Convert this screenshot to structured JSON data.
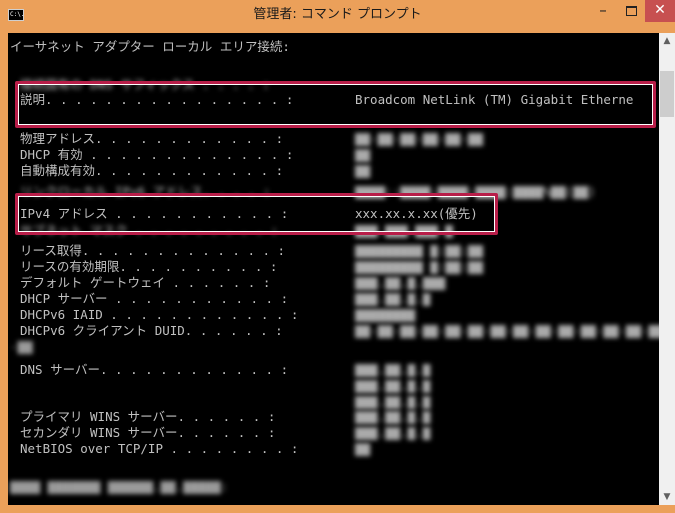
{
  "window": {
    "title": "管理者: コマンド プロンプト",
    "icon_text": "C:\\.",
    "min_label": "–",
    "close_label": "✕"
  },
  "console": {
    "header": "イーサネット アダプター ローカル エリア接続:",
    "connection_dns_suffix": {
      "label": "接続固有の DNS サフィックス . . . . :",
      "value": ""
    },
    "description": {
      "label": "説明. . . . . . . . . . . . . . . . :",
      "value": "Broadcom NetLink (TM) Gigabit Etherne"
    },
    "physical_address": {
      "label": "物理アドレス. . . . . . . . . . . . :",
      "value": ""
    },
    "dhcp_enabled": {
      "label": "DHCP 有効 . . . . . . . . . . . . . :",
      "value": ""
    },
    "autoconfig_enabled": {
      "label": "自動構成有効. . . . . . . . . . . . :",
      "value": ""
    },
    "link_local_ipv6": {
      "label": "リンクローカル IPv6 アドレス. . . . :",
      "value": ""
    },
    "ipv4_address": {
      "label": "IPv4 アドレス . . . . . . . . . . . :",
      "value": "xxx.xx.x.xx(優先)"
    },
    "subnet_mask": {
      "label": "サブネット マスク . . . . . . . . . :",
      "value": ""
    },
    "lease_obtained": {
      "label": "リース取得. . . . . . . . . . . . . :",
      "value": ""
    },
    "lease_expires": {
      "label": "リースの有効期限. . . . . . . . . . :",
      "value": ""
    },
    "default_gateway": {
      "label": "デフォルト ゲートウェイ . . . . . . :",
      "value": ""
    },
    "dhcp_server": {
      "label": "DHCP サーバー . . . . . . . . . . . :",
      "value": ""
    },
    "dhcpv6_iaid": {
      "label": "DHCPv6 IAID . . . . . . . . . . . . :",
      "value": ""
    },
    "dhcpv6_duid": {
      "label": "DHCPv6 クライアント DUID. . . . . . :",
      "value": ""
    },
    "dns_servers": {
      "label": "DNS サーバー. . . . . . . . . . . . :",
      "value": ""
    },
    "primary_wins": {
      "label": "プライマリ WINS サーバー. . . . . . :",
      "value": ""
    },
    "secondary_wins": {
      "label": "セカンダリ WINS サーバー. . . . . . :",
      "value": ""
    },
    "netbios": {
      "label": "NetBIOS over TCP/IP . . . . . . . . :",
      "value": ""
    }
  },
  "colors": {
    "title_bar": "#eba05a",
    "close_button": "#c75050",
    "console_background": "#000000",
    "console_text": "#c0c0c0",
    "highlight_border": "#b81e49"
  }
}
